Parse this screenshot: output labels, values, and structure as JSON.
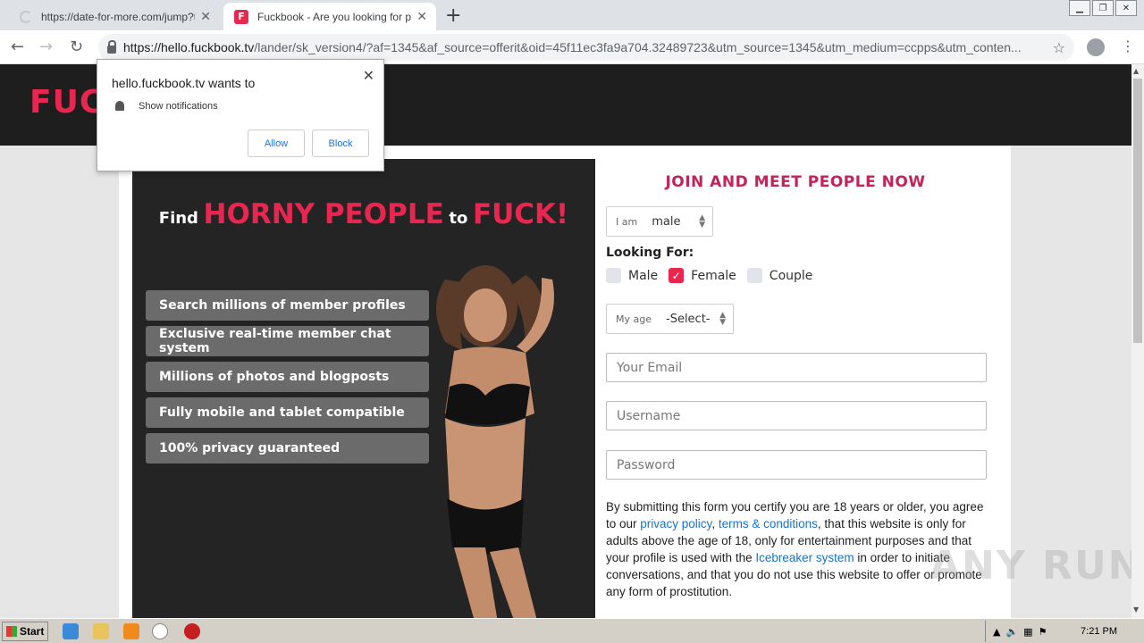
{
  "browser": {
    "tabs": [
      {
        "title": "https://date-for-more.com/jump?tds",
        "active": false
      },
      {
        "title": "Fuckbook - Are you looking for pleas",
        "active": true,
        "favicon": "F"
      }
    ],
    "url_host": "https://hello.fuckbook.tv",
    "url_path": "/lander/sk_version4/?af=1345&af_source=offerit&oid=45f11ec3fa9a704.32489723&utm_source=1345&utm_medium=ccpps&utm_conten..."
  },
  "popup": {
    "title": "hello.fuckbook.tv wants to",
    "permission": "Show notifications",
    "allow_label": "Allow",
    "block_label": "Block"
  },
  "site": {
    "logo": "FUC",
    "accent": "#e8264f"
  },
  "hero": {
    "find": "Find",
    "horny": "HORNY PEOPLE",
    "to": "to",
    "fuck": "FUCK!",
    "features": [
      "Search millions of member profiles",
      "Exclusive real-time member chat system",
      "Millions of photos and blogposts",
      "Fully mobile and tablet compatible",
      "100% privacy guaranteed"
    ]
  },
  "form": {
    "title": "JOIN AND MEET PEOPLE NOW",
    "iam_label": "I am",
    "iam_value": "male",
    "looking_for": "Looking For:",
    "options": [
      {
        "label": "Male",
        "checked": false
      },
      {
        "label": "Female",
        "checked": true
      },
      {
        "label": "Couple",
        "checked": false
      }
    ],
    "age_label": "My age",
    "age_value": "-Select-",
    "email_placeholder": "Your Email",
    "username_placeholder": "Username",
    "password_placeholder": "Password",
    "terms_1": "By submitting this form you certify you are 18 years or older, you agree to our ",
    "privacy_link": "privacy policy",
    "comma": ", ",
    "terms_link": "terms & conditions",
    "terms_2": ", that this website is only for adults above the age of 18, only for entertainment purposes and that your profile is used with the ",
    "icebreaker_link": "Icebreaker system",
    "terms_3": " in order to initiate conversations, and that you do not use this website to offer or promote any form of prostitution."
  },
  "watermark": "ANY RUN",
  "taskbar": {
    "start": "Start",
    "clock": "7:21 PM"
  }
}
